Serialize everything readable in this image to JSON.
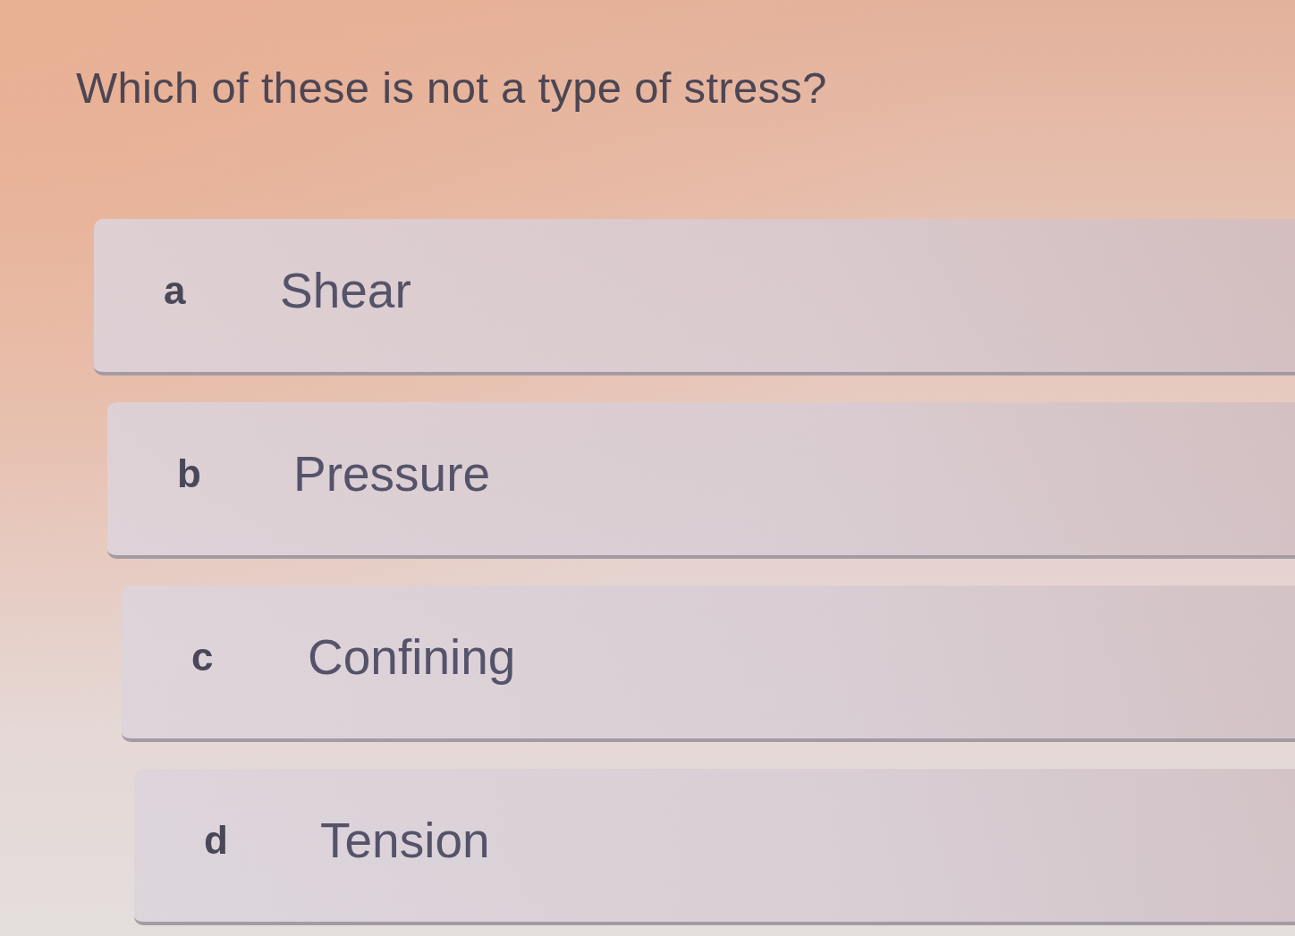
{
  "question": "Which of these is not a type of stress?",
  "options": [
    {
      "letter": "a",
      "text": "Shear",
      "selected": false
    },
    {
      "letter": "b",
      "text": "Pressure",
      "selected": false
    },
    {
      "letter": "c",
      "text": "Confining",
      "selected": false
    },
    {
      "letter": "d",
      "text": "Tension",
      "selected": false
    }
  ]
}
